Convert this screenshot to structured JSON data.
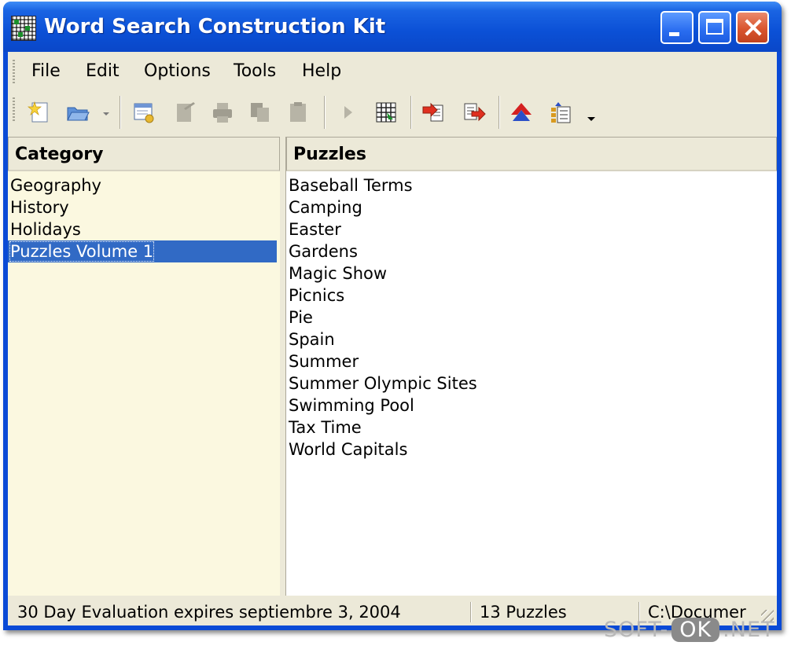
{
  "window": {
    "title": "Word Search Construction Kit"
  },
  "menu": [
    "File",
    "Edit",
    "Options",
    "Tools",
    "Help"
  ],
  "toolbar": {
    "icons": [
      "new-icon",
      "open-icon",
      "open-dropdown-icon",
      "properties-icon",
      "edit-icon",
      "print-icon",
      "copy-icon",
      "paste-icon",
      "play-icon",
      "grid-icon",
      "import-icon",
      "export-icon",
      "move-up-icon",
      "list-icon",
      "more-dropdown-icon"
    ]
  },
  "category_panel": {
    "header": "Category",
    "items": [
      "Geography",
      "History",
      "Holidays",
      "Puzzles Volume 1"
    ],
    "selected": "Puzzles Volume 1"
  },
  "puzzles_panel": {
    "header": "Puzzles",
    "items": [
      "Baseball Terms",
      "Camping",
      "Easter",
      "Gardens",
      "Magic Show",
      "Picnics",
      "Pie",
      "Spain",
      "Summer",
      "Summer Olympic Sites",
      "Swimming Pool",
      "Tax Time",
      "World Capitals"
    ]
  },
  "status": {
    "evaluation": "30 Day Evaluation expires septiembre 3, 2004",
    "count": "13 Puzzles",
    "path": "C:\\Documer"
  },
  "watermark": {
    "left": "SOFT-",
    "middle": "OK",
    "right": ".NET"
  },
  "colors": {
    "titlebar": "#0b50d6",
    "selection": "#316ac5",
    "category_bg": "#fbf8e0",
    "chrome": "#ece9d8"
  }
}
